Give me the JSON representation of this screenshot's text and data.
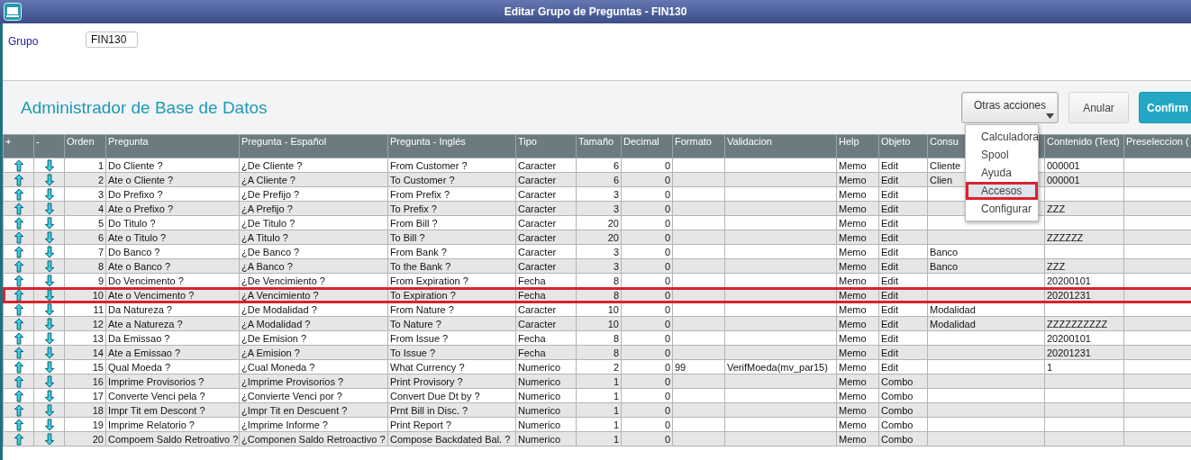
{
  "window": {
    "title": "Editar Grupo de Preguntas - FIN130"
  },
  "form": {
    "label": "Grupo",
    "value": "FIN130"
  },
  "section_title": "Administrador de Base de Datos",
  "actions": {
    "menu_button": "Otras acciones",
    "cancel": "Anular",
    "confirm": "Confirm"
  },
  "menu": {
    "items": [
      {
        "label": "Calculadora",
        "selected": false,
        "highlighted": false
      },
      {
        "label": "Spool",
        "selected": false,
        "highlighted": false
      },
      {
        "label": "Ayuda",
        "selected": false,
        "highlighted": false
      },
      {
        "label": "Accesos",
        "selected": true,
        "highlighted": true
      },
      {
        "label": "Configurar",
        "selected": false,
        "highlighted": false
      }
    ]
  },
  "table": {
    "columns": [
      "+",
      "-",
      "Orden",
      "Pregunta",
      "Pregunta - Español",
      "Pregunta - Inglés",
      "Tipo",
      "Tamaño",
      "Decimal",
      "Formato",
      "Validacion",
      "Help",
      "Objeto",
      "Consu",
      "Contenido (Text)",
      "Preseleccion ("
    ],
    "rows": [
      {
        "orden": "1",
        "pregunta": "Do Cliente ?",
        "espanol": "¿De Cliente ?",
        "ingles": "From Customer ?",
        "tipo": "Caracter",
        "tamano": "6",
        "decimal": "0",
        "help": "Memo",
        "objeto": "Edit",
        "consulta": "Cliente",
        "contenido": "000001",
        "highlighted": false
      },
      {
        "orden": "2",
        "pregunta": "Ate o Cliente ?",
        "espanol": "¿A Cliente ?",
        "ingles": "To Customer ?",
        "tipo": "Caracter",
        "tamano": "6",
        "decimal": "0",
        "help": "Memo",
        "objeto": "Edit",
        "consulta": "Clien",
        "contenido": "000001",
        "highlighted": false
      },
      {
        "orden": "3",
        "pregunta": "Do Prefixo ?",
        "espanol": "¿De Prefijo ?",
        "ingles": "From Prefix ?",
        "tipo": "Caracter",
        "tamano": "3",
        "decimal": "0",
        "help": "Memo",
        "objeto": "Edit",
        "highlighted": false
      },
      {
        "orden": "4",
        "pregunta": "Ate o Prefixo ?",
        "espanol": "¿A Prefijo ?",
        "ingles": "To Prefix ?",
        "tipo": "Caracter",
        "tamano": "3",
        "decimal": "0",
        "help": "Memo",
        "objeto": "Edit",
        "contenido": "ZZZ",
        "highlighted": false
      },
      {
        "orden": "5",
        "pregunta": "Do Titulo ?",
        "espanol": "¿De Titulo ?",
        "ingles": "From Bill ?",
        "tipo": "Caracter",
        "tamano": "20",
        "decimal": "0",
        "help": "Memo",
        "objeto": "Edit",
        "highlighted": false
      },
      {
        "orden": "6",
        "pregunta": "Ate o Titulo ?",
        "espanol": "¿A Titulo ?",
        "ingles": "To Bill ?",
        "tipo": "Caracter",
        "tamano": "20",
        "decimal": "0",
        "help": "Memo",
        "objeto": "Edit",
        "contenido": "ZZZZZZ",
        "highlighted": false
      },
      {
        "orden": "7",
        "pregunta": "Do Banco ?",
        "espanol": "¿De Banco ?",
        "ingles": "From Bank ?",
        "tipo": "Caracter",
        "tamano": "3",
        "decimal": "0",
        "help": "Memo",
        "objeto": "Edit",
        "consulta": "Banco",
        "highlighted": false
      },
      {
        "orden": "8",
        "pregunta": "Ate o Banco ?",
        "espanol": "¿A Banco ?",
        "ingles": "To the Bank ?",
        "tipo": "Caracter",
        "tamano": "3",
        "decimal": "0",
        "help": "Memo",
        "objeto": "Edit",
        "consulta": "Banco",
        "contenido": "ZZZ",
        "highlighted": false
      },
      {
        "orden": "9",
        "pregunta": "Do Vencimento ?",
        "espanol": "¿De Vencimiento ?",
        "ingles": "From Expiration ?",
        "tipo": "Fecha",
        "tamano": "8",
        "decimal": "0",
        "help": "Memo",
        "objeto": "Edit",
        "contenido": "20200101",
        "highlighted": false
      },
      {
        "orden": "10",
        "pregunta": "Ate o Vencimento ?",
        "espanol": "¿A Vencimiento ?",
        "ingles": "To Expiration ?",
        "tipo": "Fecha",
        "tamano": "8",
        "decimal": "0",
        "help": "Memo",
        "objeto": "Edit",
        "contenido": "20201231",
        "highlighted": true
      },
      {
        "orden": "11",
        "pregunta": "Da Natureza ?",
        "espanol": "¿De Modalidad ?",
        "ingles": "From Nature ?",
        "tipo": "Caracter",
        "tamano": "10",
        "decimal": "0",
        "help": "Memo",
        "objeto": "Edit",
        "consulta": "Modalidad",
        "highlighted": false
      },
      {
        "orden": "12",
        "pregunta": "Ate a Natureza ?",
        "espanol": "¿A Modalidad ?",
        "ingles": "To Nature ?",
        "tipo": "Caracter",
        "tamano": "10",
        "decimal": "0",
        "help": "Memo",
        "objeto": "Edit",
        "consulta": "Modalidad",
        "contenido": "ZZZZZZZZZZ",
        "highlighted": false
      },
      {
        "orden": "13",
        "pregunta": "Da Emissao ?",
        "espanol": "¿De Emision ?",
        "ingles": "From Issue ?",
        "tipo": "Fecha",
        "tamano": "8",
        "decimal": "0",
        "help": "Memo",
        "objeto": "Edit",
        "contenido": "20200101",
        "highlighted": false
      },
      {
        "orden": "14",
        "pregunta": "Ate a Emissao ?",
        "espanol": "¿A Emision ?",
        "ingles": "To Issue ?",
        "tipo": "Fecha",
        "tamano": "8",
        "decimal": "0",
        "help": "Memo",
        "objeto": "Edit",
        "contenido": "20201231",
        "highlighted": false
      },
      {
        "orden": "15",
        "pregunta": "Qual Moeda ?",
        "espanol": "¿Cual Moneda ?",
        "ingles": "What Currency ?",
        "tipo": "Numerico",
        "tamano": "2",
        "decimal": "0",
        "formato": "99",
        "validacion": "VerifMoeda(mv_par15)",
        "help": "Memo",
        "objeto": "Edit",
        "contenido": " 1",
        "highlighted": false
      },
      {
        "orden": "16",
        "pregunta": "Imprime Provisorios ?",
        "espanol": "¿Imprime Provisorios ?",
        "ingles": "Print Provisory ?",
        "tipo": "Numerico",
        "tamano": "1",
        "decimal": "0",
        "help": "Memo",
        "objeto": "Combo",
        "highlighted": false
      },
      {
        "orden": "17",
        "pregunta": "Converte Venci pela ?",
        "espanol": "¿Convierte Venci por ?",
        "ingles": "Convert Due Dt by ?",
        "tipo": "Numerico",
        "tamano": "1",
        "decimal": "0",
        "help": "Memo",
        "objeto": "Combo",
        "highlighted": false
      },
      {
        "orden": "18",
        "pregunta": "Impr Tit em Descont ?",
        "espanol": "¿Impr Tit en Descuent ?",
        "ingles": "Prnt Bill in Disc. ?",
        "tipo": "Numerico",
        "tamano": "1",
        "decimal": "0",
        "help": "Memo",
        "objeto": "Combo",
        "highlighted": false
      },
      {
        "orden": "19",
        "pregunta": "Imprime Relatorio ?",
        "espanol": "¿Imprime Informe ?",
        "ingles": "Print Report ?",
        "tipo": "Numerico",
        "tamano": "1",
        "decimal": "0",
        "help": "Memo",
        "objeto": "Combo",
        "highlighted": false
      },
      {
        "orden": "20",
        "pregunta": "Compoem Saldo Retroativo ?",
        "espanol": "¿Componen Saldo Retroactivo ?",
        "ingles": "Compose Backdated Bal. ?",
        "tipo": "Numerico",
        "tamano": "1",
        "decimal": "0",
        "help": "Memo",
        "objeto": "Combo",
        "highlighted": false
      }
    ]
  }
}
